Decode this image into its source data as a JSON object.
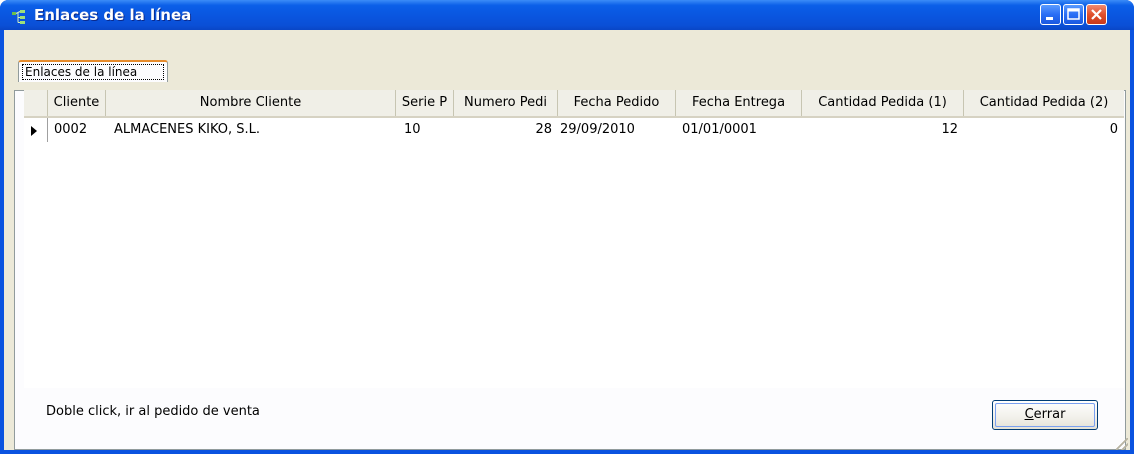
{
  "window": {
    "title": "Enlaces de la línea",
    "title_icon": "linked-tree-icon",
    "buttons": [
      "minimize",
      "maximize",
      "close"
    ]
  },
  "tabs": [
    {
      "label": "Enlaces de la línea",
      "active": true
    }
  ],
  "grid": {
    "columns": [
      "Cliente",
      "Nombre Cliente",
      "Serie P",
      "Numero Pedi",
      "Fecha Pedido",
      "Fecha Entrega",
      "Cantidad Pedida (1)",
      "Cantidad Pedida (2)"
    ],
    "rows": [
      {
        "cliente": "0002",
        "nombre_cliente": "ALMACENES KIKO, S.L.",
        "serie": "10",
        "numero_pedido": "28",
        "fecha_pedido": "29/09/2010",
        "fecha_entrega": "01/01/0001",
        "cantidad_1": "12",
        "cantidad_2": "0"
      }
    ]
  },
  "footer": {
    "hint": "Doble click, ir al pedido de venta",
    "close_button_label": "Cerrar",
    "close_button_mnemonic": "C"
  },
  "colors": {
    "titlebar": "#0a55df",
    "dialog_face": "#ece9d8",
    "tab_highlight": "#e68b2c",
    "close_button": "#e0502c"
  }
}
